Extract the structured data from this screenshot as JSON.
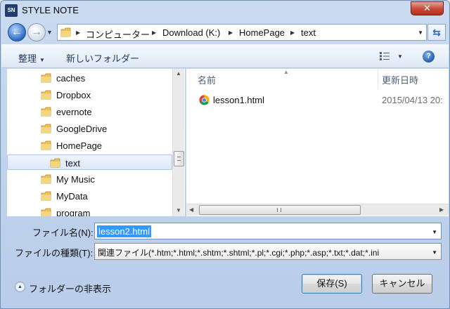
{
  "window": {
    "title": "STYLE NOTE",
    "app_icon_text": "SN",
    "close_glyph": "✕"
  },
  "nav_buttons": {
    "back_glyph": "←",
    "forward_glyph": "→"
  },
  "address": {
    "crumbs": [
      "コンピューター",
      "Download (K:)",
      "HomePage",
      "text"
    ]
  },
  "toolbar": {
    "organize_label": "整理",
    "new_folder_label": "新しいフォルダー",
    "help_glyph": "?"
  },
  "nav_pane": {
    "items": [
      {
        "label": "caches",
        "selected": false
      },
      {
        "label": "Dropbox",
        "selected": false
      },
      {
        "label": "evernote",
        "selected": false
      },
      {
        "label": "GoogleDrive",
        "selected": false
      },
      {
        "label": "HomePage",
        "selected": false
      },
      {
        "label": "text",
        "selected": true
      },
      {
        "label": "My Music",
        "selected": false
      },
      {
        "label": "MyData",
        "selected": false
      },
      {
        "label": "program",
        "selected": false
      }
    ]
  },
  "file_list": {
    "columns": {
      "name": "名前",
      "modified": "更新日時"
    },
    "files": [
      {
        "name": "lesson1.html",
        "modified": "2015/04/13 20:"
      }
    ]
  },
  "form": {
    "filename_label": "ファイル名(N):",
    "filename_value": "lesson2.html",
    "filetype_label": "ファイルの種類(T):",
    "filetype_value": "関連ファイル(*.htm;*.html;*.shtm;*.shtml;*.pl;*.cgi;*.php;*.asp;*.txt;*.dat;*.ini"
  },
  "footer": {
    "hide_folders_label": "フォルダーの非表示",
    "save_label": "保存(S)",
    "cancel_label": "キャンセル"
  },
  "colors": {
    "selection": "#3399ff",
    "title_bar": "#c9daf0",
    "close_button": "#c94635",
    "folder": "#e9c25a"
  }
}
